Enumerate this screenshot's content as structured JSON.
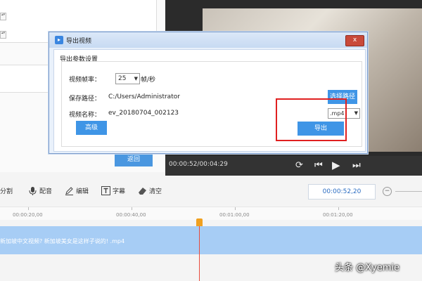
{
  "background_app": {
    "spin_arrow": "▴▾",
    "back_button_label": "返回",
    "player": {
      "time": "00:00:52/00:04:29",
      "icons": [
        "rotate-icon",
        "skip-back-icon",
        "play-icon",
        "skip-forward-icon"
      ]
    },
    "edit_toolbar": {
      "tools": [
        {
          "label": "分割",
          "icon": "split-icon"
        },
        {
          "label": "配音",
          "icon": "microphone-icon"
        },
        {
          "label": "编辑",
          "icon": "pencil-icon"
        },
        {
          "label": "字幕",
          "icon": "text-icon"
        },
        {
          "label": "清空",
          "icon": "eraser-icon"
        }
      ],
      "current_time": "00:00:52,20",
      "zoom_minus": "−"
    },
    "ruler": {
      "ticks": [
        "00:00:20,00",
        "00:00:40,00",
        "00:01:00,00",
        "00:01:20,00"
      ]
    },
    "track": {
      "clip_label": "新加坡中文视频? 新加坡美女是这样子说的! .mp4"
    },
    "watermark": "头条 @Xyemie"
  },
  "dialog": {
    "title": "导出视频",
    "close_label": "x",
    "section_title": "导出参数设置",
    "fps_label": "视频帧率：",
    "fps_value": "25",
    "fps_unit": "帧/秒",
    "path_label": "保存路径：",
    "path_value": "C:/Users/Administrator",
    "choose_path_label": "选择路径",
    "name_label": "视频名称：",
    "name_value": "ev_20180704_002123",
    "format_value": ".mp4",
    "advanced_label": "高级",
    "export_label": "导出"
  },
  "colors": {
    "accent": "#3f95e6",
    "highlight": "#e02020",
    "playhead": "#e84c3d",
    "track": "#a7cdf5"
  }
}
